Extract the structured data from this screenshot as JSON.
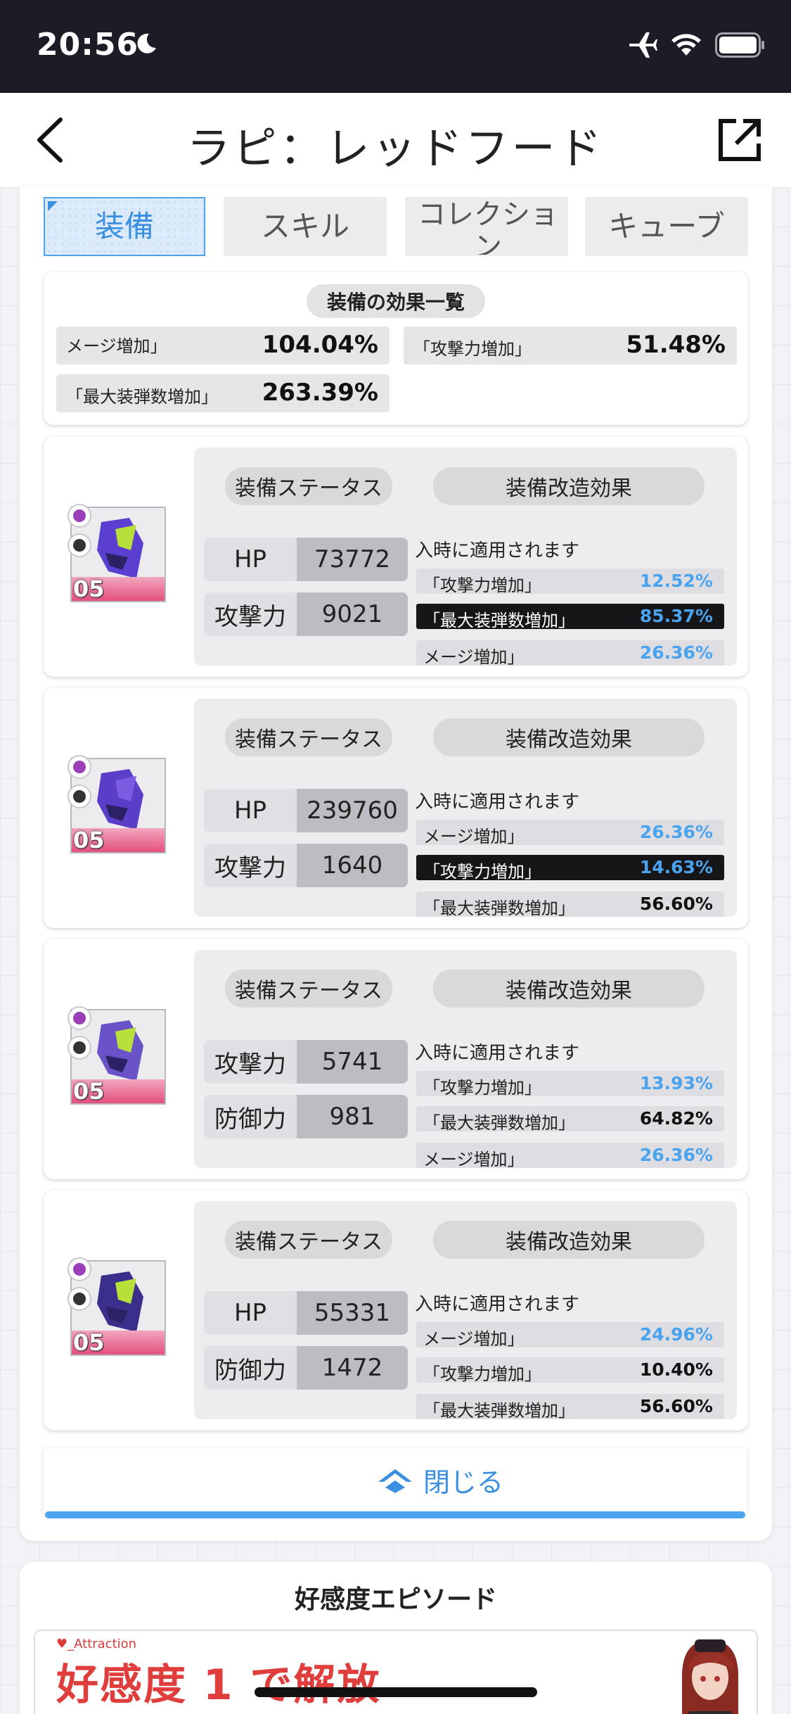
{
  "status_bar": {
    "time": "20:56",
    "icons": [
      "moon-icon",
      "airplane-icon",
      "wifi-icon",
      "battery-icon"
    ]
  },
  "header": {
    "title": "ラピ：レッドフード"
  },
  "tabs": [
    {
      "label": "装備",
      "active": true
    },
    {
      "label": "スキル",
      "active": false
    },
    {
      "label": "コレクション",
      "active": false
    },
    {
      "label": "キューブ",
      "active": false
    }
  ],
  "summary": {
    "title": "装備の効果一覧",
    "effects": [
      {
        "label": "メージ増加」",
        "value": "104.04%"
      },
      {
        "label": "「攻撃力増加」",
        "value": "51.48%"
      },
      {
        "label": "「最大装弾数増加」",
        "value": "263.39%"
      }
    ]
  },
  "equipment_common": {
    "status_label": "装備ステータス",
    "mod_label": "装備改造効果",
    "applies_text": "入時に適用されます"
  },
  "equipment": [
    {
      "level": "05",
      "stats": [
        {
          "name": "HP",
          "value": "73772"
        },
        {
          "name": "攻撃力",
          "value": "9021"
        }
      ],
      "mods": [
        {
          "label": "「攻撃力増加」",
          "value": "12.52%",
          "highlight": false,
          "blue": true
        },
        {
          "label": "「最大装弾数増加」",
          "value": "85.37%",
          "highlight": true,
          "blue": true
        },
        {
          "label": "メージ増加」",
          "value": "26.36%",
          "highlight": false,
          "blue": true
        }
      ]
    },
    {
      "level": "05",
      "stats": [
        {
          "name": "HP",
          "value": "239760"
        },
        {
          "name": "攻撃力",
          "value": "1640"
        }
      ],
      "mods": [
        {
          "label": "メージ増加」",
          "value": "26.36%",
          "highlight": false,
          "blue": true
        },
        {
          "label": "「攻撃力増加」",
          "value": "14.63%",
          "highlight": true,
          "blue": true
        },
        {
          "label": "「最大装弾数増加」",
          "value": "56.60%",
          "highlight": false,
          "blue": false
        }
      ]
    },
    {
      "level": "05",
      "stats": [
        {
          "name": "攻撃力",
          "value": "5741"
        },
        {
          "name": "防御力",
          "value": "981"
        }
      ],
      "mods": [
        {
          "label": "「攻撃力増加」",
          "value": "13.93%",
          "highlight": false,
          "blue": true
        },
        {
          "label": "「最大装弾数増加」",
          "value": "64.82%",
          "highlight": false,
          "blue": false
        },
        {
          "label": "メージ増加」",
          "value": "26.36%",
          "highlight": false,
          "blue": true
        }
      ]
    },
    {
      "level": "05",
      "stats": [
        {
          "name": "HP",
          "value": "55331"
        },
        {
          "name": "防御力",
          "value": "1472"
        }
      ],
      "mods": [
        {
          "label": "メージ増加」",
          "value": "24.96%",
          "highlight": false,
          "blue": true
        },
        {
          "label": "「攻撃力増加」",
          "value": "10.40%",
          "highlight": false,
          "blue": false
        },
        {
          "label": "「最大装弾数増加」",
          "value": "56.60%",
          "highlight": false,
          "blue": false
        }
      ]
    }
  ],
  "close_button": {
    "label": "閉じる"
  },
  "affection": {
    "heading": "好感度エピソード",
    "tag": "♥_Attraction",
    "unlock_text": "好感度 1 で解放"
  },
  "colors": {
    "accent": "#4ea3ee",
    "highlight_row": "#161618",
    "unlock_red": "#e03d3d",
    "status_bar": "#1b1c26"
  }
}
